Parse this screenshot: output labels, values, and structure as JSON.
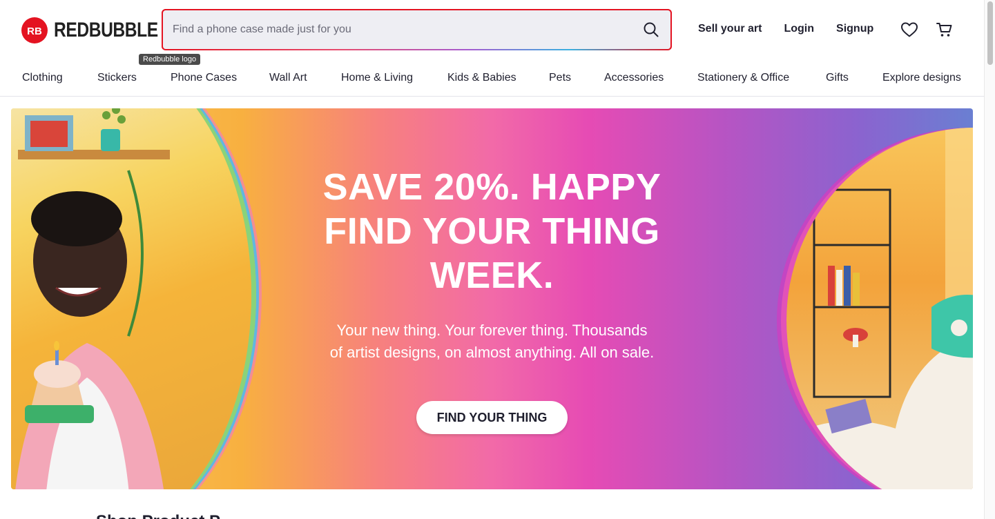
{
  "brand": {
    "name": "REDBUBBLE",
    "logo_letters": "RB",
    "tooltip": "Redbubble logo",
    "accent_color": "#e41321"
  },
  "search": {
    "placeholder": "Find a phone case made just for you",
    "value": "",
    "icon": "search-icon"
  },
  "header_links": {
    "sell": "Sell your art",
    "login": "Login",
    "signup": "Signup"
  },
  "header_icons": [
    "heart-icon",
    "cart-icon"
  ],
  "categories": [
    "Clothing",
    "Stickers",
    "Phone Cases",
    "Wall Art",
    "Home & Living",
    "Kids & Babies",
    "Pets",
    "Accessories",
    "Stationery & Office",
    "Gifts",
    "Explore designs"
  ],
  "hero": {
    "title": "SAVE 20%. HAPPY FIND YOUR THING WEEK.",
    "subtitle": "Your new thing. Your forever thing. Thousands of artist designs, on almost anything. All on sale.",
    "cta": "FIND YOUR THING"
  },
  "below_fold": {
    "heading_partial": "Shop Product P"
  }
}
